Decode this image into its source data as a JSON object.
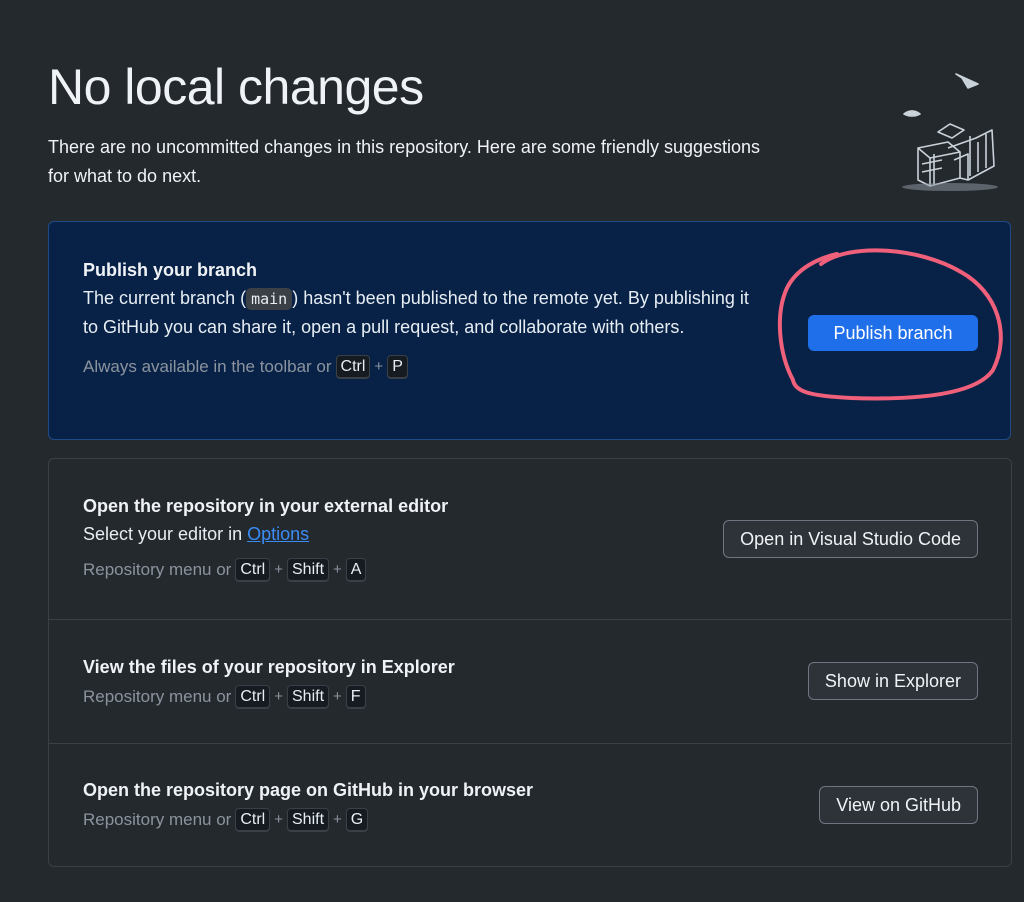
{
  "header": {
    "title": "No local changes",
    "subtitle": "There are no uncommitted changes in this repository. Here are some friendly suggestions for what to do next."
  },
  "publish": {
    "title": "Publish your branch",
    "desc_before": "The current branch (",
    "branch": "main",
    "desc_after": ") hasn't been published to the remote yet. By publishing it to GitHub you can share it, open a pull request, and collaborate with others.",
    "hint": "Always available in the toolbar or",
    "keys": [
      "Ctrl",
      "P"
    ],
    "button_label": "Publish branch"
  },
  "suggestions": [
    {
      "title": "Open the repository in your external editor",
      "desc_prefix": "Select your editor in",
      "link": "Options",
      "hint": "Repository menu or",
      "keys": [
        "Ctrl",
        "Shift",
        "A"
      ],
      "button_label": "Open in Visual Studio Code"
    },
    {
      "title": "View the files of your repository in Explorer",
      "hint": "Repository menu or",
      "keys": [
        "Ctrl",
        "Shift",
        "F"
      ],
      "button_label": "Show in Explorer"
    },
    {
      "title": "Open the repository page on GitHub in your browser",
      "hint": "Repository menu or",
      "keys": [
        "Ctrl",
        "Shift",
        "G"
      ],
      "button_label": "View on GitHub"
    }
  ],
  "plus_sign": "+",
  "colors": {
    "background": "#24292e",
    "publish_card": "#082247",
    "primary_button": "#1f6feb",
    "link": "#3a8cf5",
    "highlight_ring": "#f0607a"
  }
}
